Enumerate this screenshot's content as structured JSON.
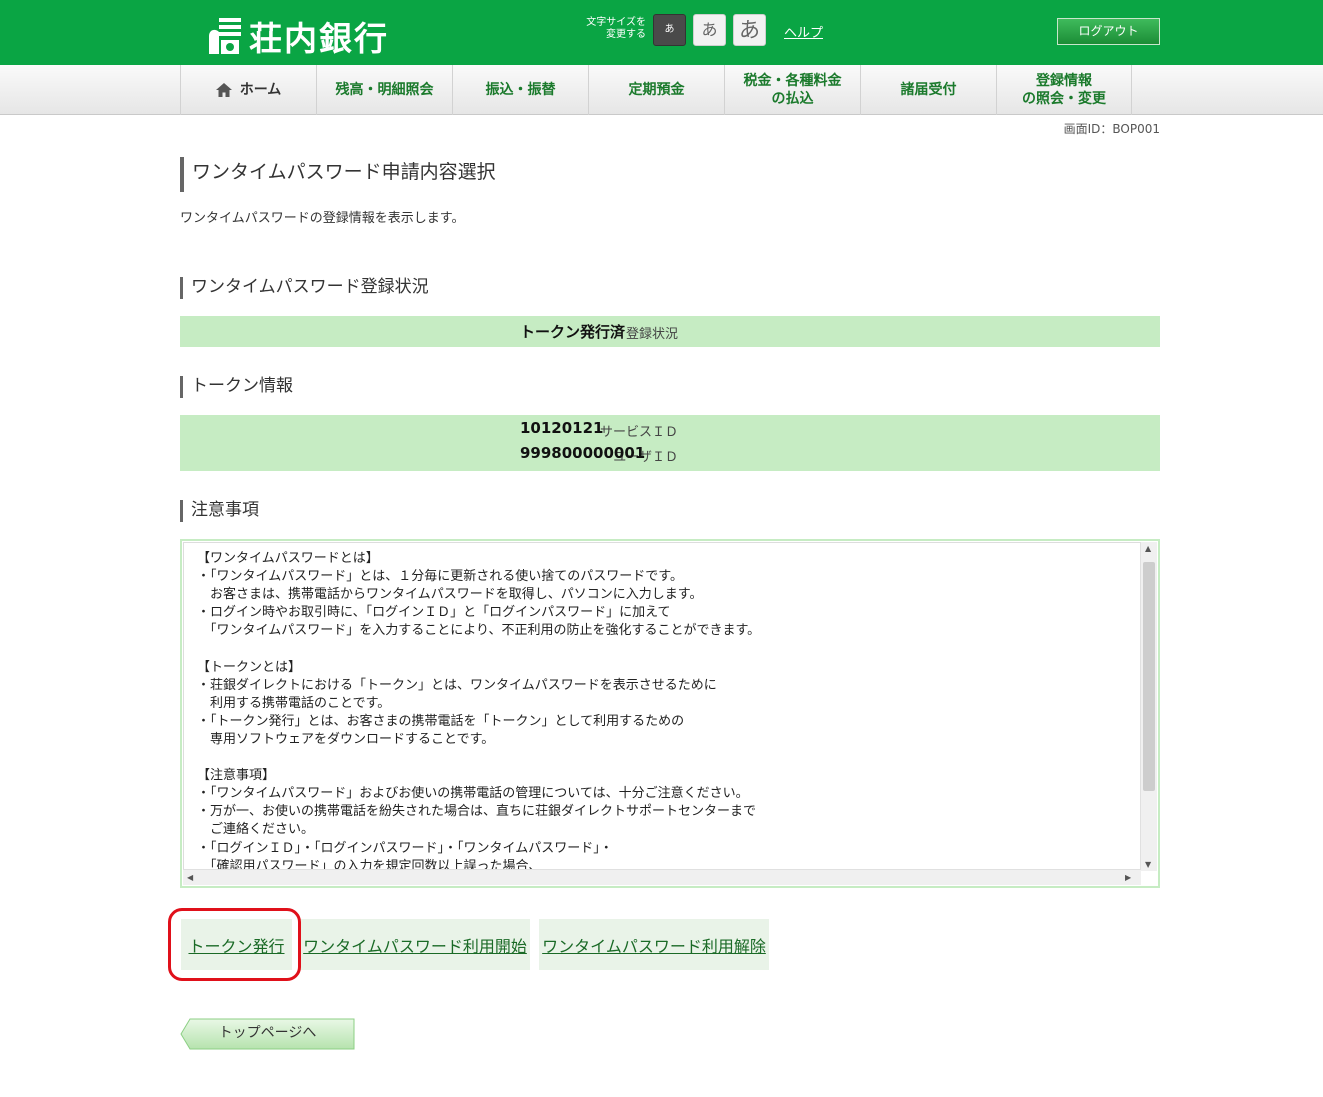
{
  "header": {
    "bank_name": "荘内銀行",
    "font_size_label_line1": "文字サイズを",
    "font_size_label_line2": "変更する",
    "font_size_small": "あ",
    "font_size_medium": "あ",
    "font_size_large": "あ",
    "help": "ヘルプ",
    "logout": "ログアウト",
    "brand_color": "#0aa544"
  },
  "nav": {
    "items": [
      {
        "label": "ホーム",
        "icon": "home-icon"
      },
      {
        "label": "残高・明細照会"
      },
      {
        "label": "振込・振替"
      },
      {
        "label": "定期預金"
      },
      {
        "label": "税金・各種料金\nの払込"
      },
      {
        "label": "諸届受付"
      },
      {
        "label": "登録情報\nの照会・変更"
      }
    ]
  },
  "screen_id": "画面ID：BOP001",
  "page": {
    "title": "ワンタイムパスワード申請内容選択",
    "description": "ワンタイムパスワードの登録情報を表示します。"
  },
  "registration": {
    "heading": "ワンタイムパスワード登録状況",
    "label": "登録状況",
    "value": "トークン発行済"
  },
  "token_info": {
    "heading": "トークン情報",
    "service_id_label": "サービスＩＤ",
    "service_id": "10120121",
    "user_id_label": "ユーザＩＤ",
    "user_id": "999800000001"
  },
  "notes": {
    "heading": "注意事項",
    "text": "【ワンタイムパスワードとは】\n・「ワンタイムパスワード」とは、１分毎に更新される使い捨てのパスワードです。\n　お客さまは、携帯電話からワンタイムパスワードを取得し、パソコンに入力します。\n・ログイン時やお取引時に、「ログインＩＤ」と「ログインパスワード」に加えて\n　「ワンタイムパスワード」を入力することにより、不正利用の防止を強化することができます。\n\n【トークンとは】\n・荘銀ダイレクトにおける「トークン」とは、ワンタイムパスワードを表示させるために\n　利用する携帯電話のことです。\n・「トークン発行」とは、お客さまの携帯電話を「トークン」として利用するための\n　専用ソフトウェアをダウンロードすることです。\n\n【注意事項】\n・「ワンタイムパスワード」およびお使いの携帯電話の管理については、十分ご注意ください。\n・万が一、お使いの携帯電話を紛失された場合は、直ちに荘銀ダイレクトサポートセンターまで\n　ご連絡ください。\n・「ログインＩＤ」・「ログインパスワード」・「ワンタイムパスワード」・\n　「確認用パスワード」の入力を規定回数以上誤った場合、"
  },
  "actions": {
    "issue_token": "トークン発行",
    "start_otp": "ワンタイムパスワード利用開始",
    "cancel_otp": "ワンタイムパスワード利用解除"
  },
  "top_page": "トップページへ"
}
